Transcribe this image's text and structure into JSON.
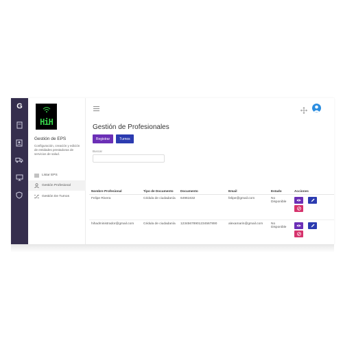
{
  "rail": {
    "logo": "G",
    "icons": [
      "document-icon",
      "contacts-icon",
      "truck-icon",
      "monitor-icon",
      "shield-icon"
    ]
  },
  "sidebar": {
    "logo_text": "HiH",
    "title": "Gestión de EPS",
    "description": "Configuración, creación y edición de entidades prestadoras de servicios de salud.",
    "items": [
      {
        "label": "Listar EPS",
        "icon": "list-icon",
        "active": false
      },
      {
        "label": "Gestión Profesional",
        "icon": "user-icon",
        "active": true
      },
      {
        "label": "Gestión De Turnos",
        "icon": "shuffle-icon",
        "active": false
      }
    ]
  },
  "header": {
    "menu_icon": "hamburger-icon",
    "move_icon": "move-icon",
    "avatar_icon": "user-avatar-icon"
  },
  "page": {
    "title": "Gestión de Profesionales",
    "register_label": "Registrar",
    "shifts_label": "Turnos",
    "search_label": "Buscar",
    "search_value": "",
    "search_placeholder": ""
  },
  "table": {
    "headers": [
      "Nombre Profesional",
      "Tipo de Documento",
      "Documento",
      "Email",
      "Estado",
      "Acciones"
    ],
    "rows": [
      [
        "Felipe Rivera",
        "Cédula de ciudadanía",
        "64961632",
        "felipe@gmail.com",
        "No Disponible"
      ],
      [
        "hihadministrador@gmail.com",
        "Cédula de ciudadanía",
        "12345678901234567890",
        "alexamarin@gmail.com",
        "No Disponible"
      ]
    ]
  },
  "colors": {
    "rail_bg": "#352e4d",
    "primary_purple": "#6b2fb6",
    "primary_blue": "#2b3bb0",
    "danger": "#d6336c",
    "logo_green": "#37d54a",
    "avatar_blue": "#2b8de0"
  }
}
